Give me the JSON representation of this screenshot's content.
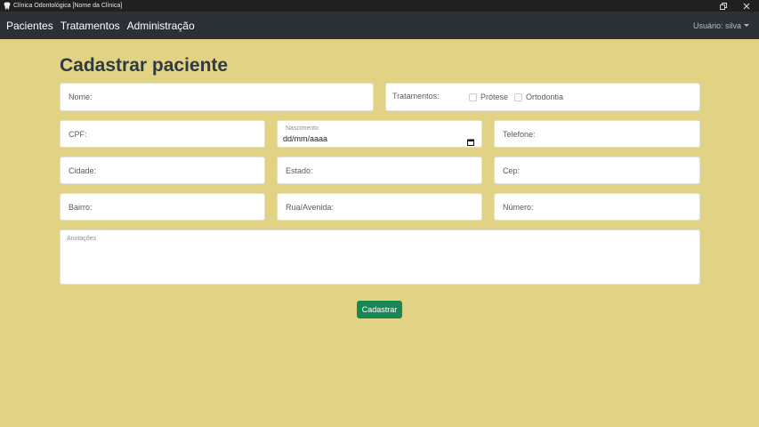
{
  "window": {
    "title": "Clínica Odontológica [Nome da Clínica]",
    "app_icon": "tooth-icon",
    "buttons": [
      "restore-icon",
      "close-icon"
    ]
  },
  "navbar": {
    "items": [
      "Pacientes",
      "Tratamentos",
      "Administração"
    ],
    "user_label": "Usuário: silva"
  },
  "page": {
    "title": "Cadastrar paciente"
  },
  "form": {
    "nome": "Nome:",
    "tratamentos": {
      "label": "Tratamentos:",
      "options": [
        {
          "label": "Prótese",
          "checked": false
        },
        {
          "label": "Ortodontia",
          "checked": false
        }
      ]
    },
    "cpf": "CPF:",
    "nascimento": {
      "label": "Nascimento",
      "value": "dd/mm/aaaa"
    },
    "telefone": "Telefone:",
    "cidade": "Cidade:",
    "estado": "Estado:",
    "cep": "Cep:",
    "bairro": "Bairro:",
    "rua": "Rua/Avenida:",
    "numero": "Número:",
    "anotacoes": "Anotações",
    "submit_label": "Cadastrar"
  },
  "colors": {
    "background": "#e2d384",
    "navbar": "#2b3137",
    "title": "#2f3a45",
    "submit": "#198754"
  }
}
